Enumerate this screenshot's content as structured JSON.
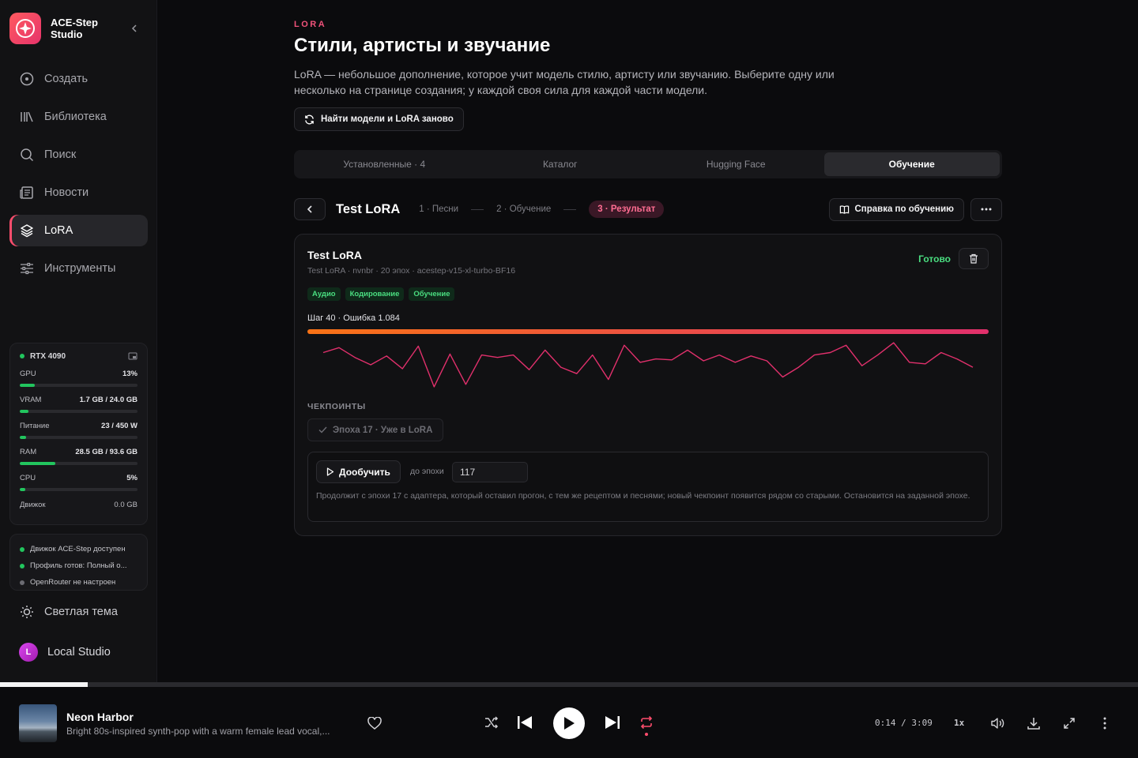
{
  "brand": {
    "name": "ACE-Step Studio"
  },
  "nav": [
    {
      "label": "Создать",
      "icon": "create-icon"
    },
    {
      "label": "Библиотека",
      "icon": "library-icon"
    },
    {
      "label": "Поиск",
      "icon": "search-icon"
    },
    {
      "label": "Новости",
      "icon": "news-icon"
    },
    {
      "label": "LoRA",
      "icon": "layers-icon",
      "active": true
    },
    {
      "label": "Инструменты",
      "icon": "sliders-icon"
    }
  ],
  "hardware": {
    "gpu_name": "RTX 4090",
    "metrics": [
      {
        "label": "GPU",
        "value": "13%",
        "fraction": 0.13
      },
      {
        "label": "VRAM",
        "value": "1.7 GB / 24.0 GB",
        "fraction": 0.071
      },
      {
        "label": "Питание",
        "value": "23 / 450 W",
        "fraction": 0.051
      },
      {
        "label": "RAM",
        "value": "28.5 GB / 93.6 GB",
        "fraction": 0.305
      },
      {
        "label": "CPU",
        "value": "5%",
        "fraction": 0.05
      }
    ],
    "engine": {
      "label": "Движок",
      "value": "0.0 GB"
    }
  },
  "status_lines": [
    {
      "text": "Движок ACE-Step доступен",
      "color": "#22c55e"
    },
    {
      "text": "Профиль готов: Полный о...",
      "color": "#22c55e"
    },
    {
      "text": "OpenRouter не настроен",
      "color": "#6b6b72"
    }
  ],
  "theme_toggle": "Светлая тема",
  "profile": {
    "initial": "L",
    "name": "Local Studio"
  },
  "page": {
    "eyebrow": "LORA",
    "title": "Стили, артисты и звучание",
    "description": "LoRA — небольшое дополнение, которое учит модель стилю, артисту или звучанию. Выберите одну или несколько на странице создания; у каждой своя сила для каждой части модели.",
    "refresh_label": "Найти модели и LoRA заново"
  },
  "tabs": [
    {
      "label": "Установленные · 4",
      "active": false
    },
    {
      "label": "Каталог",
      "active": false
    },
    {
      "label": "Hugging Face",
      "active": false
    },
    {
      "label": "Обучение",
      "active": true
    }
  ],
  "wizard": {
    "title": "Test LoRA",
    "steps": [
      "1 · Песни",
      "2 · Обучение",
      "3 · Результат"
    ],
    "current_step": 3,
    "help_label": "Справка по обучению"
  },
  "result": {
    "title": "Test LoRA",
    "meta": "Test LoRA · nvnbr · 20 эпох · acestep-v15-xl-turbo-BF16",
    "status": "Готово",
    "tags": [
      "Аудио",
      "Кодирование",
      "Обучение"
    ],
    "step_text": "Шаг 40 · Ошибка 1.084",
    "progress_fraction": 1.0,
    "checkpoints_label": "ЧЕКПОИНТЫ",
    "checkpoint_chip": "Эпоха 17 · Уже в LoRA",
    "resume_label": "Дообучить",
    "until_label": "до эпохи",
    "until_value": "117",
    "resume_note": "Продолжит с эпохи 17 с адаптера, который оставил прогон, с тем же рецептом и песнями; новый чекпоинт появится рядом со старыми. Остановится на заданной эпохе."
  },
  "chart_data": {
    "type": "line",
    "title": "",
    "xlabel": "",
    "ylabel": "",
    "x": [
      1,
      2,
      3,
      4,
      5,
      6,
      7,
      8,
      9,
      10,
      11,
      12,
      13,
      14,
      15,
      16,
      17,
      18,
      19,
      20,
      21,
      22,
      23,
      24,
      25,
      26,
      27,
      28,
      29,
      30,
      31,
      32,
      33,
      34,
      35,
      36,
      37,
      38,
      39,
      40
    ],
    "series": [
      {
        "color": "#e1306c",
        "values": [
          0.25,
          0.15,
          0.35,
          0.5,
          0.32,
          0.58,
          0.12,
          0.95,
          0.28,
          0.9,
          0.3,
          0.35,
          0.3,
          0.6,
          0.2,
          0.55,
          0.68,
          0.3,
          0.8,
          0.1,
          0.45,
          0.38,
          0.4,
          0.2,
          0.42,
          0.3,
          0.45,
          0.32,
          0.42,
          0.75,
          0.55,
          0.3,
          0.25,
          0.1,
          0.52,
          0.3,
          0.05,
          0.45,
          0.48,
          0.25,
          0.38,
          0.55
        ]
      }
    ],
    "ylim": [
      0,
      1
    ],
    "grid": false
  },
  "player": {
    "title": "Neon Harbor",
    "subtitle": "Bright 80s-inspired synth-pop with a warm female lead vocal,...",
    "time": "0:14 / 3:09",
    "speed": "1x",
    "progress_fraction": 0.077,
    "accent": "#ff4d6d"
  }
}
